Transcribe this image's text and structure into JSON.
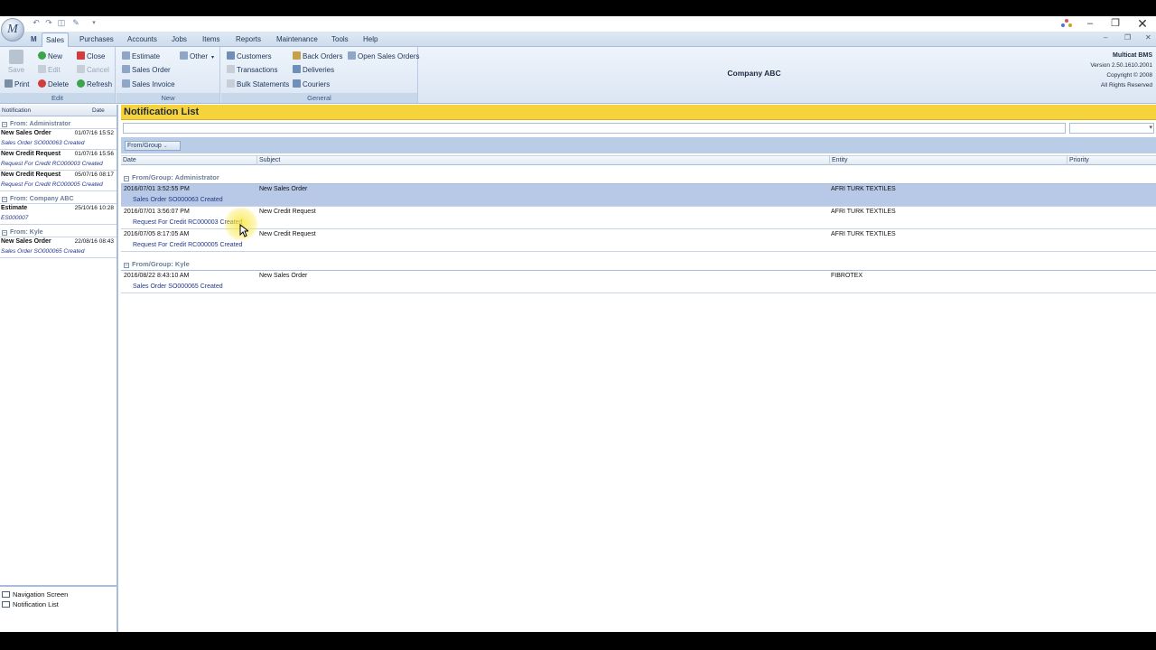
{
  "menu": {
    "tabs": [
      "Sales",
      "Purchases",
      "Accounts",
      "Jobs",
      "Items",
      "Reports",
      "Maintenance",
      "Tools",
      "Help"
    ],
    "active": "Sales"
  },
  "ribbon": {
    "edit": {
      "label": "Edit",
      "save": "Save",
      "new": "New",
      "close": "Close",
      "edit": "Edit",
      "cancel": "Cancel",
      "print": "Print",
      "delete": "Delete",
      "refresh": "Refresh"
    },
    "new_group": {
      "label": "New",
      "estimate": "Estimate",
      "other": "Other",
      "sales_order": "Sales Order",
      "sales_invoice": "Sales Invoice"
    },
    "general": {
      "label": "General",
      "customers": "Customers",
      "back_orders": "Back Orders",
      "open_sales_orders": "Open Sales Orders",
      "transactions": "Transactions",
      "deliveries": "Deliveries",
      "bulk_statements": "Bulk Statements",
      "couriers": "Couriers"
    },
    "company": "Company ABC",
    "about": {
      "product": "Multicat BMS",
      "version": "Version 2.50.1610.2001",
      "copyright": "Copyright © 2008",
      "rights": "All Rights Reserved"
    }
  },
  "left_pane": {
    "col_notification": "Notification",
    "col_date": "Date",
    "groups": [
      {
        "label": "From: Administrator",
        "items": [
          {
            "title": "New Sales Order",
            "date": "01/07/16 15:52",
            "sub": "Sales Order SO000063 Created"
          },
          {
            "title": "New Credit Request",
            "date": "01/07/16 15:56",
            "sub": "Request For Credit RC000003 Created"
          },
          {
            "title": "New Credit Request",
            "date": "05/07/16 08:17",
            "sub": "Request For Credit RC000005 Created"
          }
        ]
      },
      {
        "label": "From: Company ABC",
        "items": [
          {
            "title": "Estimate",
            "date": "25/10/16 10:28",
            "sub": "ES000007"
          }
        ]
      },
      {
        "label": "From: Kyle",
        "items": [
          {
            "title": "New Sales Order",
            "date": "22/08/16 08:43",
            "sub": "Sales Order SO000065 Created"
          }
        ]
      }
    ],
    "nav": [
      "Navigation Screen",
      "Notification List"
    ]
  },
  "main": {
    "title": "Notification List",
    "group_chip": "From/Group",
    "columns": [
      "Date",
      "Subject",
      "Entity",
      "Priority"
    ],
    "groups": [
      {
        "label": "From/Group:  Administrator",
        "rows": [
          {
            "date": "2016/07/01 3:52:55 PM",
            "subject": "New Sales Order",
            "entity": "AFRI TURK TEXTILES",
            "sub": "Sales Order SO000063 Created",
            "selected": true
          },
          {
            "date": "2016/07/01 3:56:07 PM",
            "subject": "New Credit Request",
            "entity": "AFRI TURK TEXTILES",
            "sub": "Request For Credit RC000003 Created",
            "selected": false
          },
          {
            "date": "2016/07/05 8:17:05 AM",
            "subject": "New Credit Request",
            "entity": "AFRI TURK TEXTILES",
            "sub": "Request For Credit RC000005 Created",
            "selected": false
          }
        ]
      },
      {
        "label": "From/Group:  Kyle",
        "rows": [
          {
            "date": "2016/08/22 8:43:10 AM",
            "subject": "New Sales Order",
            "entity": "FIBROTEX",
            "sub": "Sales Order SO000065 Created",
            "selected": false
          }
        ]
      }
    ]
  },
  "colors": {
    "title_bar": "#f6d23b",
    "selected_row": "#b7c9e6",
    "group_panel": "#b9cde6"
  }
}
